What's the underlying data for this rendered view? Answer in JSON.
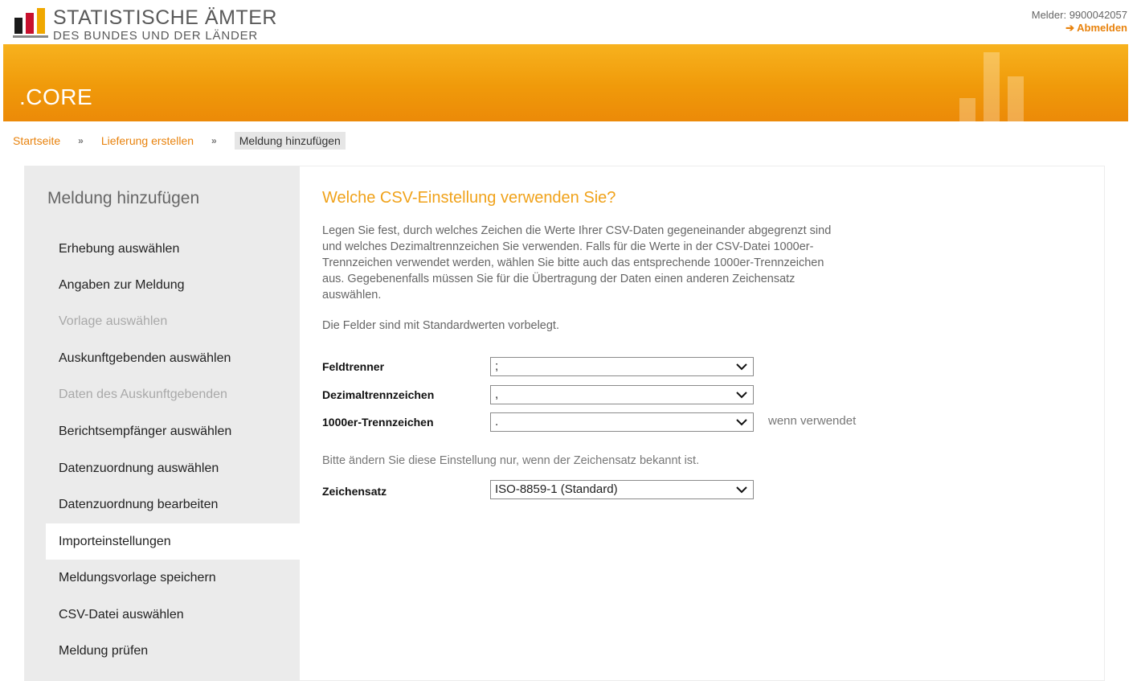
{
  "header": {
    "logo_line1": "STATISTISCHE ÄMTER",
    "logo_line2": "DES BUNDES UND DER LÄNDER",
    "melder": "Melder: 9900042057",
    "logout": "➔ Abmelden"
  },
  "banner": {
    "title": ".CORE"
  },
  "breadcrumb": {
    "items": [
      "Startseite",
      "Lieferung erstellen"
    ],
    "separator": "»",
    "current": "Meldung hinzufügen"
  },
  "sidebar": {
    "title": "Meldung hinzufügen",
    "items": [
      {
        "label": "Erhebung auswählen"
      },
      {
        "label": "Angaben zur Meldung"
      },
      {
        "label": "Vorlage auswählen"
      },
      {
        "label": "Auskunftgebenden auswählen"
      },
      {
        "label": "Daten des Auskunftgebenden"
      },
      {
        "label": "Berichtsempfänger auswählen"
      },
      {
        "label": "Datenzuordnung auswählen"
      },
      {
        "label": "Datenzuordnung bearbeiten"
      },
      {
        "label": "Importeinstellungen"
      },
      {
        "label": "Meldungsvorlage speichern"
      },
      {
        "label": "CSV-Datei auswählen"
      },
      {
        "label": "Meldung prüfen"
      }
    ]
  },
  "main": {
    "title": "Welche CSV-Einstellung verwenden Sie?",
    "description": "Legen Sie fest, durch welches Zeichen die Werte Ihrer CSV-Daten gegeneinander abgegrenzt sind und welches Dezimaltrennzeichen Sie verwenden. Falls für die Werte in der CSV-Datei 1000er-Trennzeichen verwendet werden, wählen Sie bitte auch das entsprechende 1000er-Trennzeichen aus. Gegebenenfalls müssen Sie für die Übertragung der Daten einen anderen Zeichensatz auswählen.",
    "defaults_note": "Die Felder sind mit Standardwerten vorbelegt.",
    "fields": {
      "feldtrenner": {
        "label": "Feldtrenner",
        "value": ";"
      },
      "dezimal": {
        "label": "Dezimaltrennzeichen",
        "value": ","
      },
      "tausender": {
        "label": "1000er-Trennzeichen",
        "value": ".",
        "hint": "wenn verwendet"
      }
    },
    "charset_note": "Bitte ändern Sie diese Einstellung nur, wenn der Zeichensatz bekannt ist.",
    "charset": {
      "label": "Zeichensatz",
      "value": "ISO-8859-1 (Standard)"
    }
  },
  "colors": {
    "accent": "#f0a21a",
    "link": "#e8820c",
    "sidebar_bg": "#ebebeb"
  }
}
